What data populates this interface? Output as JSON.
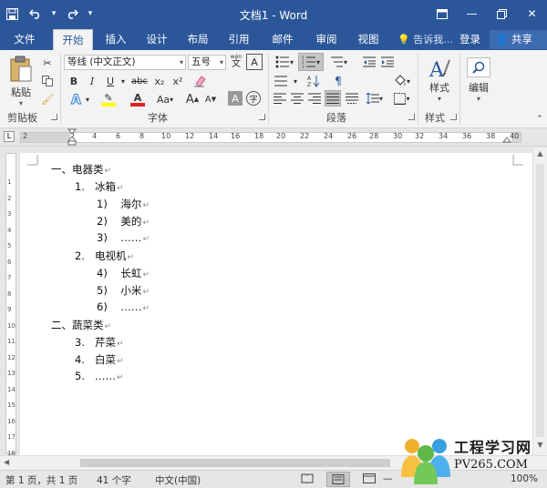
{
  "window": {
    "title": "文档1 - Word"
  },
  "tabs": {
    "file": "文件",
    "home": "开始",
    "insert": "插入",
    "design": "设计",
    "layout": "布局",
    "references": "引用",
    "mailings": "邮件",
    "review": "审阅",
    "view": "视图",
    "tell_me": "告诉我...",
    "sign_in": "登录",
    "share": "共享"
  },
  "ribbon": {
    "clipboard": {
      "label": "剪贴板",
      "paste": "粘贴"
    },
    "font": {
      "label": "字体",
      "font_name": "等线 (中文正文)",
      "font_size": "五号",
      "wen": "wén",
      "wen_char": "文",
      "a_box": "A",
      "bold": "B",
      "italic": "I",
      "underline": "U",
      "strike": "abc",
      "subscript": "x₂",
      "superscript": "x²",
      "grow": "A",
      "shrink": "A",
      "change_case": "Aa",
      "char_shading": "A",
      "enclose": "字"
    },
    "paragraph": {
      "label": "段落"
    },
    "styles": {
      "label": "样式",
      "button": "样式"
    },
    "editing": {
      "button": "编辑"
    }
  },
  "ruler": {
    "numbers": [
      "2",
      "2",
      "4",
      "6",
      "8",
      "10",
      "12",
      "14",
      "16",
      "18",
      "20",
      "22",
      "24",
      "26",
      "28",
      "30",
      "32",
      "34",
      "36",
      "38",
      "40"
    ],
    "vnumbers": [
      "1",
      "2",
      "3",
      "4",
      "5",
      "6",
      "7",
      "8",
      "9",
      "10",
      "11",
      "12",
      "13",
      "14",
      "15",
      "16",
      "17",
      "18"
    ]
  },
  "document": {
    "lines": [
      {
        "text": "一、电器类"
      },
      {
        "text": "1.   冰箱"
      },
      {
        "text": "1)    海尔"
      },
      {
        "text": "2)    美的"
      },
      {
        "text": "3)    ……"
      },
      {
        "text": "2.   电视机"
      },
      {
        "text": "4)    长虹"
      },
      {
        "text": "5)    小米"
      },
      {
        "text": "6)    ……"
      },
      {
        "text": "二、蔬菜类"
      },
      {
        "text": "3.   芹菜"
      },
      {
        "text": "4.   白菜"
      },
      {
        "text": "5.   ……"
      }
    ],
    "para_mark": "↵"
  },
  "status": {
    "page": "第 1 页，共 1 页",
    "words": "41 个字",
    "language": "中文(中国)",
    "zoom": "100%"
  },
  "watermark": {
    "text": "工程学习网",
    "url": "PV265.COM"
  }
}
